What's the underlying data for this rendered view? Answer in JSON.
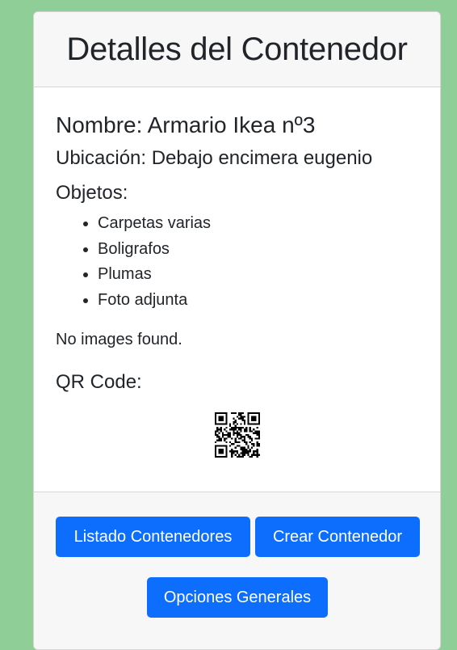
{
  "header": {
    "title": "Detalles del Contenedor"
  },
  "container": {
    "nombre": "Nombre: Armario Ikea nº3",
    "ubicacion": "Ubicación: Debajo encimera eugenio",
    "objetos_label": "Objetos:",
    "objetos": [
      "Carpetas varias",
      "Boligrafos",
      "Plumas",
      "Foto adjunta"
    ],
    "images_status": "No images found.",
    "qr_label": "QR Code:"
  },
  "footer": {
    "listado_label": "Listado Contenedores",
    "crear_label": "Crear Contenedor",
    "opciones_label": "Opciones Generales"
  },
  "colors": {
    "page_background": "#8fce97",
    "button_primary": "#0d6efd",
    "card_header_background": "#f7f7f7"
  }
}
